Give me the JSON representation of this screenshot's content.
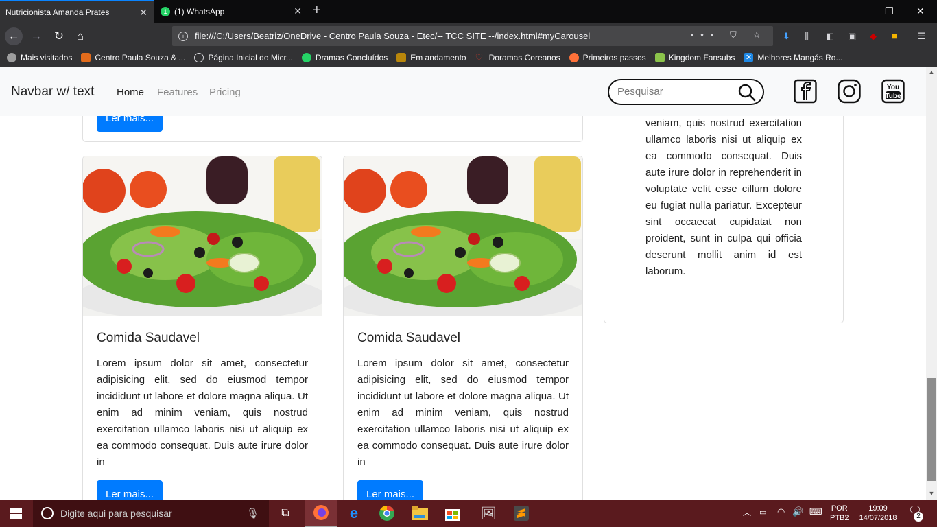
{
  "browser": {
    "tabs": [
      {
        "label": "Nutricionista Amanda Prates",
        "active": true
      },
      {
        "label": "(1) WhatsApp",
        "active": false,
        "badge": "1"
      }
    ],
    "url": "file:///C:/Users/Beatriz/OneDrive - Centro Paula Souza - Etec/-- TCC SITE --/index.html#myCarousel",
    "bookmarks": [
      {
        "label": "Mais visitados",
        "icon": "gear-icon",
        "color": "#9e9e9e"
      },
      {
        "label": "Centro Paula Souza & ...",
        "icon": "cps-icon",
        "color": "#e36c1c"
      },
      {
        "label": "Página Inicial do Micr...",
        "icon": "globe-icon",
        "color": "#d7d7db"
      },
      {
        "label": "Dramas Concluídos",
        "icon": "whatsapp-icon",
        "color": "#25d366"
      },
      {
        "label": "Em andamento",
        "icon": "film-icon",
        "color": "#b8860b"
      },
      {
        "label": "Doramas Coreanos",
        "icon": "heart-icon",
        "color": "#c0392b"
      },
      {
        "label": "Primeiros passos",
        "icon": "firefox-icon",
        "color": "#ff7139"
      },
      {
        "label": "Kingdom Fansubs",
        "icon": "chat-icon",
        "color": "#8bc34a"
      },
      {
        "label": "Melhores Mangás Ro...",
        "icon": "x-icon",
        "color": "#1e88e5"
      }
    ]
  },
  "site": {
    "brand": "Navbar w/ text",
    "nav": [
      "Home",
      "Features",
      "Pricing"
    ],
    "search_placeholder": "Pesquisar",
    "social": [
      "facebook-icon",
      "instagram-icon",
      "youtube-icon"
    ],
    "youtube_text": [
      "You",
      "Tube"
    ]
  },
  "top_card": {
    "button": "Ler mais..."
  },
  "cards": [
    {
      "title": "Comida Saudavel",
      "text": "Lorem ipsum dolor sit amet, consectetur adipisicing elit, sed do eiusmod tempor incididunt ut labore et dolore magna aliqua. Ut enim ad minim veniam, quis nostrud exercitation ullamco laboris nisi ut aliquip ex ea commodo consequat. Duis aute irure dolor in",
      "button": "Ler mais..."
    },
    {
      "title": "Comida Saudavel",
      "text": "Lorem ipsum dolor sit amet, consectetur adipisicing elit, sed do eiusmod tempor incididunt ut labore et dolore magna aliqua. Ut enim ad minim veniam, quis nostrud exercitation ullamco laboris nisi ut aliquip ex ea commodo consequat. Duis aute irure dolor in",
      "button": "Ler mais..."
    }
  ],
  "aside": {
    "text": "veniam, quis nostrud exercitation ullamco laboris nisi ut aliquip ex ea commodo consequat. Duis aute irure dolor in reprehenderit in voluptate velit esse cillum dolore eu fugiat nulla pariatur. Excepteur sint occaecat cupidatat non proident, sunt in culpa qui officia deserunt mollit anim id est laborum."
  },
  "taskbar": {
    "search_placeholder": "Digite aqui para pesquisar",
    "lang_top": "POR",
    "lang_bottom": "PTB2",
    "time": "19:09",
    "date": "14/07/2018",
    "notifications": "2"
  },
  "colors": {
    "accent": "#007bff",
    "taskbar": "#5a1a1e"
  }
}
